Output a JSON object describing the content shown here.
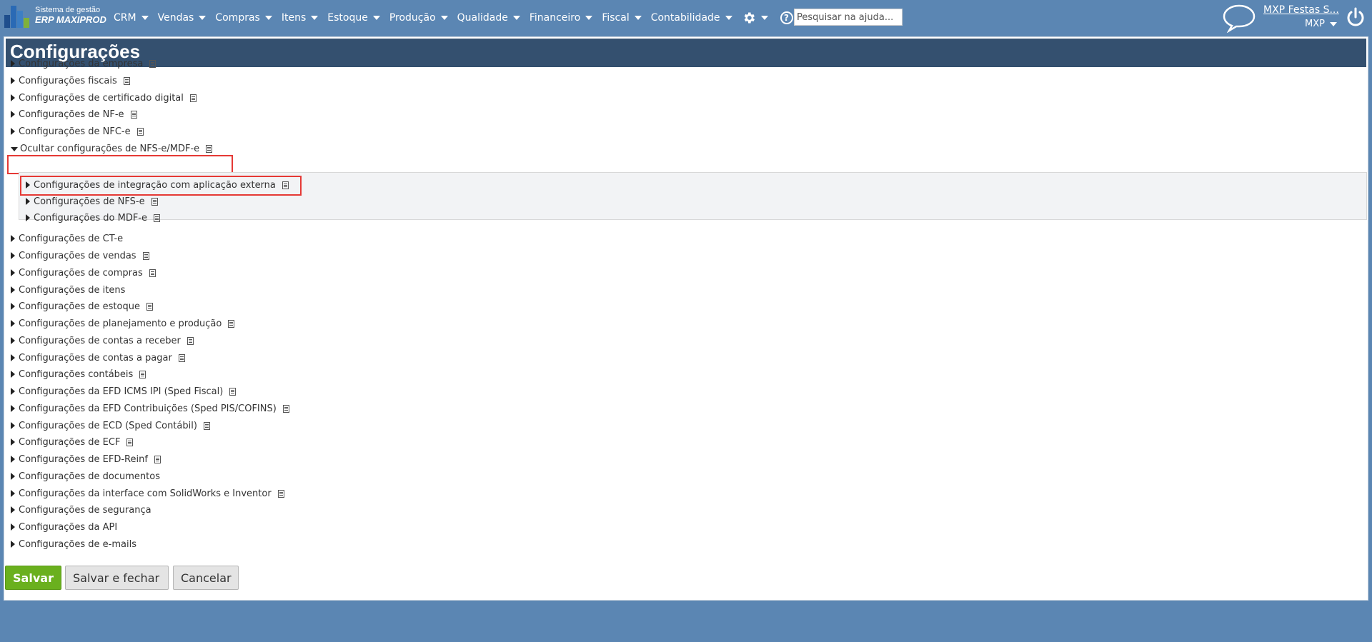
{
  "brand": {
    "line1": "Sistema de gestão",
    "line2": "ERP MAXIPROD"
  },
  "menu": [
    "CRM",
    "Vendas",
    "Compras",
    "Itens",
    "Estoque",
    "Produção",
    "Qualidade",
    "Financeiro",
    "Fiscal",
    "Contabilidade"
  ],
  "search": {
    "placeholder": "Pesquisar na ajuda..."
  },
  "user": {
    "name": "MXP Festas S...",
    "company": "MXP"
  },
  "page": {
    "title": "Configurações"
  },
  "tree": {
    "top": [
      "Configurações da empresa",
      "Configurações fiscais",
      "Configurações de certificado digital",
      "Configurações de NF-e",
      "Configurações de NFC-e"
    ],
    "expanded_label": "Ocultar configurações de NFS-e/MDF-e",
    "children": [
      "Configurações de integração com aplicação externa",
      "Configurações de NFS-e",
      "Configurações do MDF-e"
    ],
    "bottom": [
      "Configurações de CT-e",
      "Configurações de vendas",
      "Configurações de compras",
      "Configurações de itens",
      "Configurações de estoque",
      "Configurações de planejamento e produção",
      "Configurações de contas a receber",
      "Configurações de contas a pagar",
      "Configurações contábeis",
      "Configurações da EFD ICMS IPI (Sped Fiscal)",
      "Configurações da EFD Contribuições (Sped PIS/COFINS)",
      "Configurações de ECD (Sped Contábil)",
      "Configurações de ECF",
      "Configurações de EFD-Reinf",
      "Configurações de documentos",
      "Configurações da interface com SolidWorks e Inventor",
      "Configurações de segurança",
      "Configurações da API",
      "Configurações de e-mails"
    ]
  },
  "buttons": {
    "save": "Salvar",
    "save_close": "Salvar e fechar",
    "cancel": "Cancelar"
  },
  "colors": {
    "topbar": "#5b86b3",
    "header": "#34506f",
    "save_button": "#6ab01e",
    "highlight": "#e53935"
  }
}
